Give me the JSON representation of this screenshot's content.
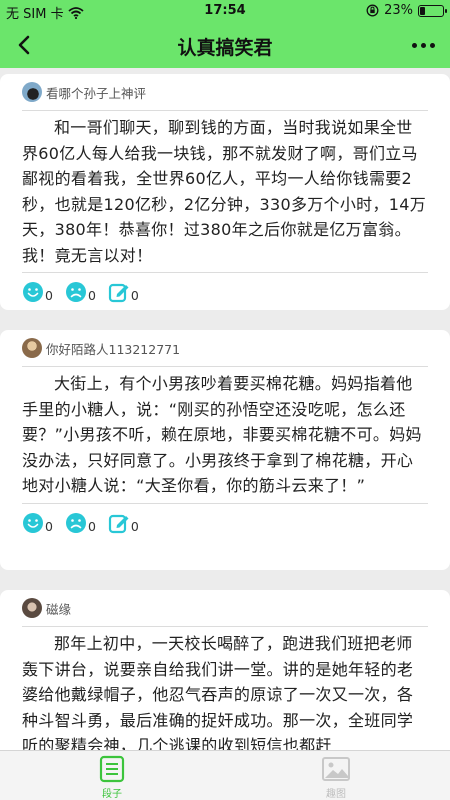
{
  "status_bar": {
    "carrier": "无 SIM 卡",
    "time": "17:54",
    "battery_percent": "23%",
    "battery_level": 0.23
  },
  "nav": {
    "title": "认真搞笑君",
    "back_icon": "chevron-left-icon",
    "more_icon": "more-dots-icon"
  },
  "posts": [
    {
      "username": "看哪个孙子上神评",
      "content": "和一哥们聊天，聊到钱的方面，当时我说如果全世界60亿人每人给我一块钱，那不就发财了啊，哥们立马鄙视的看着我，全世界60亿人，平均一人给你钱需要2秒，也就是120亿秒，2亿分钟，330多万个小时，14万天，380年！恭喜你！过380年之后你就是亿万富翁。我！竟无言以对！",
      "smile_count": "0",
      "sad_count": "0",
      "comment_count": "0"
    },
    {
      "username": "你好陌路人113212771",
      "content": "大街上，有个小男孩吵着要买棉花糖。妈妈指着他手里的小糖人，说：“刚买的孙悟空还没吃呢，怎么还要？”小男孩不听，赖在原地，非要买棉花糖不可。妈妈没办法，只好同意了。小男孩终于拿到了棉花糖，开心地对小糖人说：“大圣你看，你的筋斗云来了！”",
      "smile_count": "0",
      "sad_count": "0",
      "comment_count": "0"
    },
    {
      "username": "磁缘",
      "content": "那年上初中，一天校长喝醉了，跑进我们班把老师轰下讲台，说要亲自给我们讲一堂。讲的是她年轻的老婆给他戴绿帽子，他忍气吞声的原谅了一次又一次，各种斗智斗勇，最后准确的捉奸成功。那一次，全班同学听的聚精会神，几个逃课的收到短信也都赶"
    }
  ],
  "tabs": [
    {
      "label": "段子",
      "icon": "list-doc-icon",
      "active": true
    },
    {
      "label": "趣图",
      "icon": "image-icon",
      "active": false
    }
  ],
  "colors": {
    "accent": "#6be56b",
    "icon_teal": "#28c7d6",
    "tab_active": "#3cc43c",
    "tab_inactive": "#bdbdbd"
  }
}
